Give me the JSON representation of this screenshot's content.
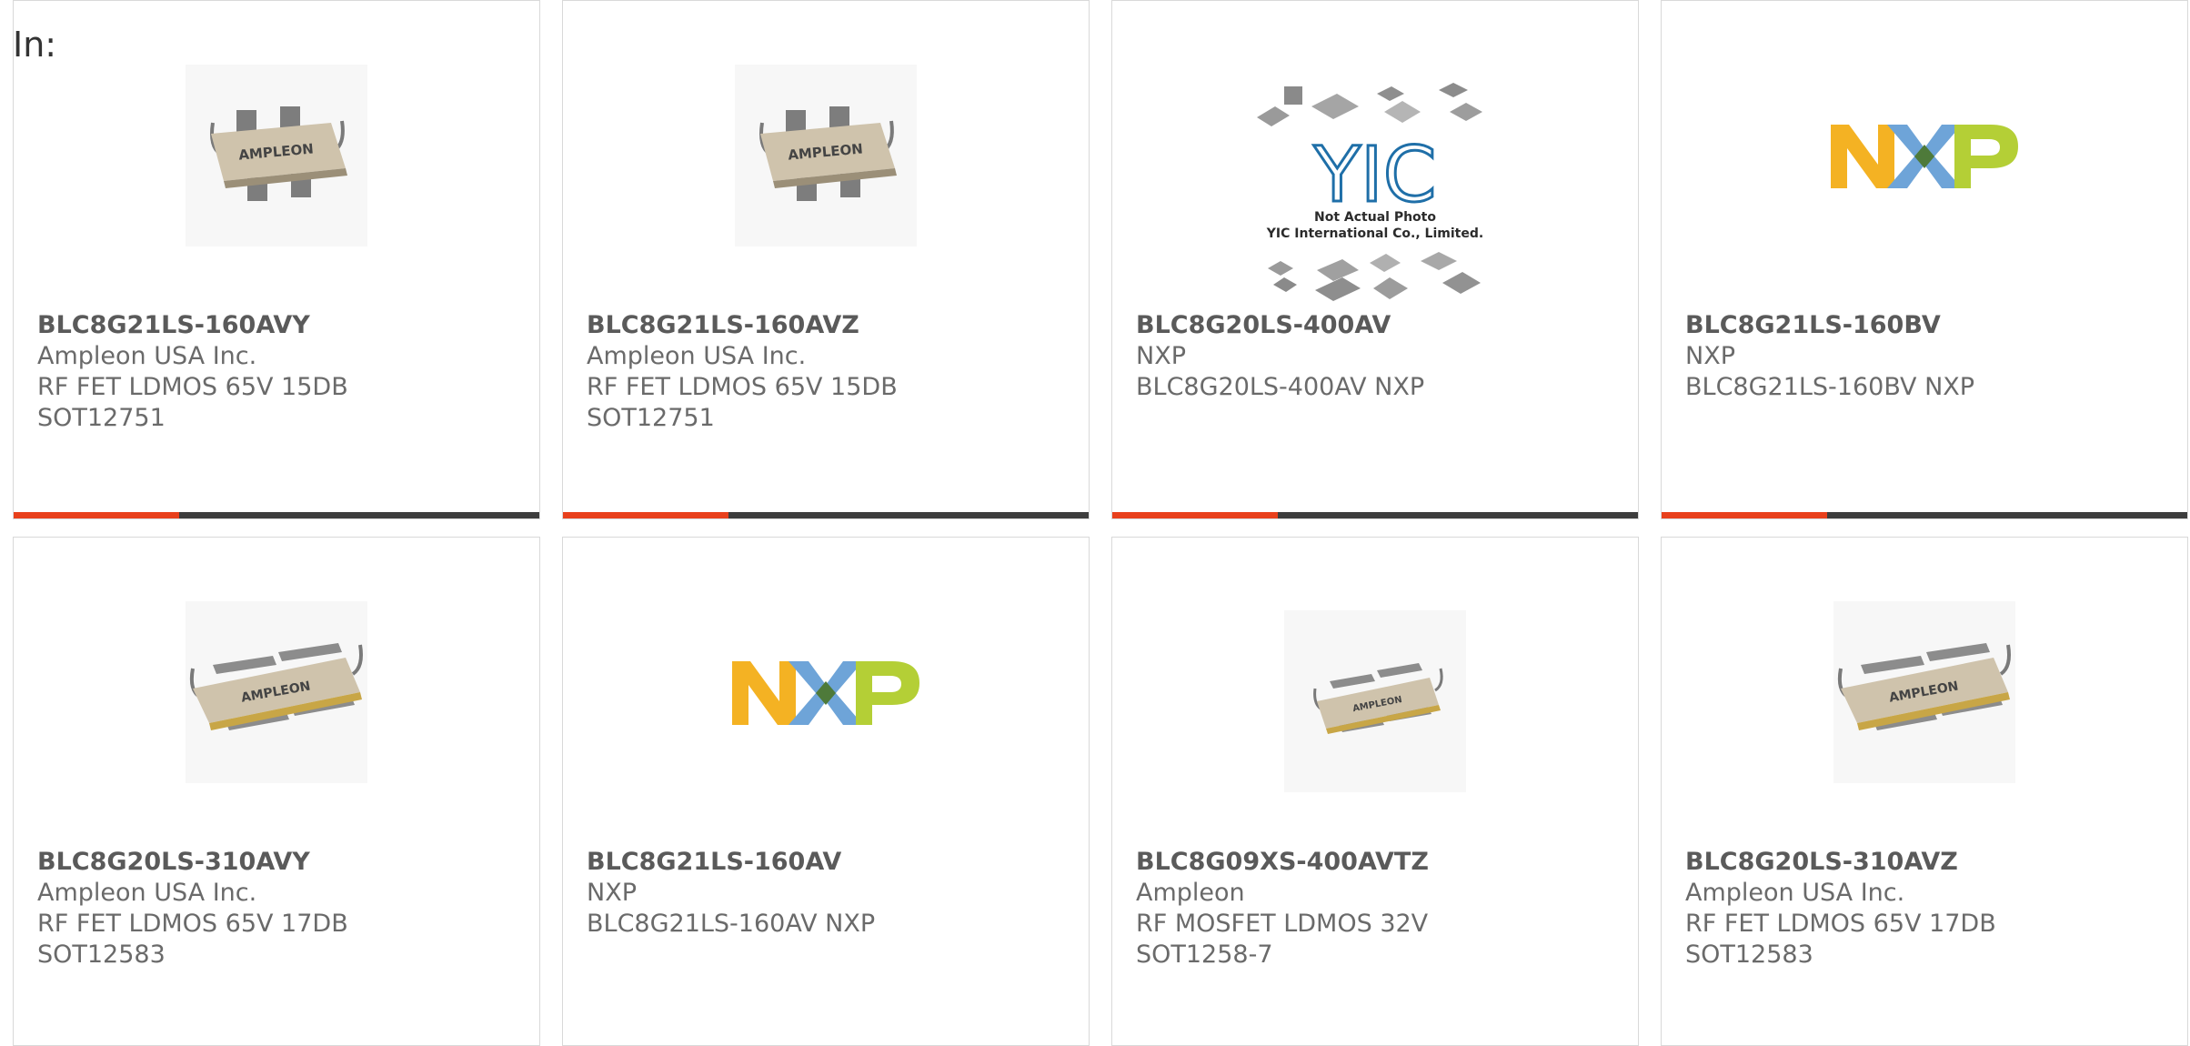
{
  "header": {
    "label": "In:"
  },
  "colors": {
    "accent": "#e8401c",
    "bar_dark": "#3d3d3d"
  },
  "products": [
    {
      "part_number": "BLC8G21LS-160AVY",
      "manufacturer": "Ampleon USA Inc.",
      "line1": "RF FET LDMOS 65V 15DB",
      "line2": "SOT12751",
      "image": "ampleon-package-4lead",
      "image_text": "AMPLEON"
    },
    {
      "part_number": "BLC8G21LS-160AVZ",
      "manufacturer": "Ampleon USA Inc.",
      "line1": "RF FET LDMOS 65V 15DB",
      "line2": "SOT12751",
      "image": "ampleon-package-4lead",
      "image_text": "AMPLEON"
    },
    {
      "part_number": "BLC8G20LS-400AV",
      "manufacturer": "NXP",
      "line1": "BLC8G20LS-400AV NXP",
      "line2": "",
      "image": "yic-placeholder",
      "image_text": "YIC",
      "image_caption1": "Not Actual Photo",
      "image_caption2": "YIC International Co., Limited."
    },
    {
      "part_number": "BLC8G21LS-160BV",
      "manufacturer": "NXP",
      "line1": "BLC8G21LS-160BV NXP",
      "line2": "",
      "image": "nxp-logo",
      "image_text": "NXP"
    },
    {
      "part_number": "BLC8G20LS-310AVY",
      "manufacturer": "Ampleon USA Inc.",
      "line1": "RF FET LDMOS 65V 17DB",
      "line2": "SOT12583",
      "image": "ampleon-package-flat",
      "image_text": "AMPLEON"
    },
    {
      "part_number": "BLC8G21LS-160AV",
      "manufacturer": "NXP",
      "line1": "BLC8G21LS-160AV NXP",
      "line2": "",
      "image": "nxp-logo",
      "image_text": "NXP"
    },
    {
      "part_number": "BLC8G09XS-400AVTZ",
      "manufacturer": "Ampleon",
      "line1": "RF MOSFET LDMOS 32V",
      "line2": "SOT1258-7",
      "image": "ampleon-package-small",
      "image_text": "AMPLEON"
    },
    {
      "part_number": "BLC8G20LS-310AVZ",
      "manufacturer": "Ampleon USA Inc.",
      "line1": "RF FET LDMOS 65V 17DB",
      "line2": "SOT12583",
      "image": "ampleon-package-flat",
      "image_text": "AMPLEON"
    }
  ]
}
